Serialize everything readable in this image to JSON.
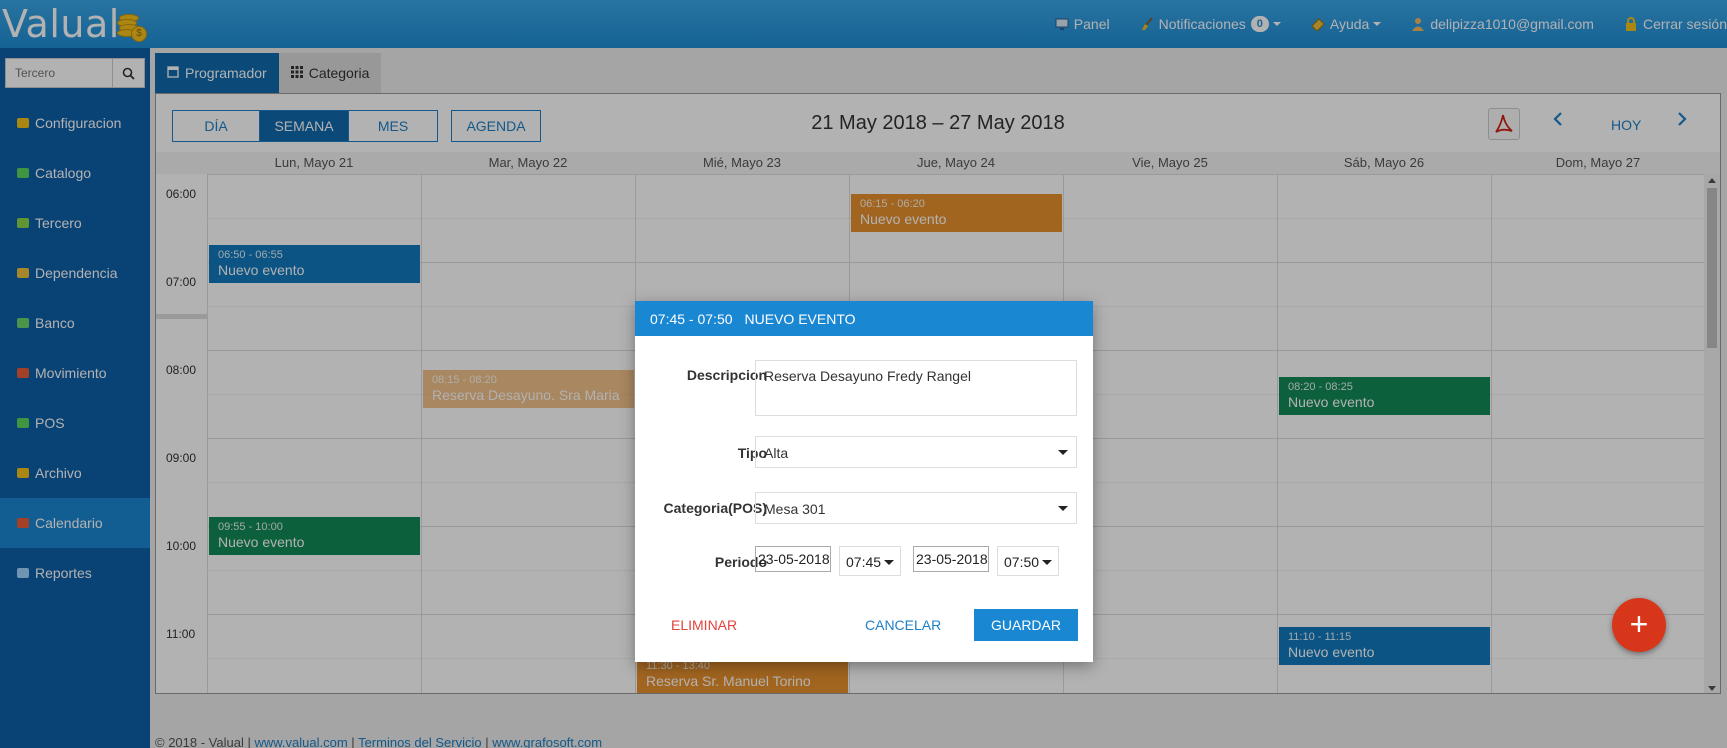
{
  "brand": {
    "logo": "Valual"
  },
  "topnav": {
    "panel": "Panel",
    "notifications": "Notificaciones",
    "notifications_count": "0",
    "help": "Ayuda",
    "user": "delipizza1010@gmail.com",
    "logout": "Cerrar sesión"
  },
  "sidebar": {
    "search_placeholder": "Tercero",
    "items": [
      {
        "label": "Configuracion",
        "icon": "gear-icon",
        "color": "#f4c21c"
      },
      {
        "label": "Catalogo",
        "icon": "share-nodes-icon",
        "color": "#5cd65c"
      },
      {
        "label": "Tercero",
        "icon": "user-icon",
        "color": "#8bd64a"
      },
      {
        "label": "Dependencia",
        "icon": "sitemap-icon",
        "color": "#f0c040"
      },
      {
        "label": "Banco",
        "icon": "money-icon",
        "color": "#6cd66c"
      },
      {
        "label": "Movimiento",
        "icon": "boxes-icon",
        "color": "#e85c3a"
      },
      {
        "label": "POS",
        "icon": "pos-icon",
        "color": "#5cd65c"
      },
      {
        "label": "Archivo",
        "icon": "archive-icon",
        "color": "#f4c21c"
      },
      {
        "label": "Calendario",
        "icon": "calendar-icon",
        "color": "#e85c3a"
      },
      {
        "label": "Reportes",
        "icon": "printer-icon",
        "color": "#9fd6ff"
      }
    ]
  },
  "tabs": {
    "programador": "Programador",
    "categoria": "Categoria"
  },
  "calendar": {
    "views": {
      "day": "DÍA",
      "week": "SEMANA",
      "month": "MES",
      "agenda": "AGENDA"
    },
    "range": "21 May 2018 – 27 May 2018",
    "today": "HOY",
    "days": [
      "Lun, Mayo 21",
      "Mar, Mayo 22",
      "Mié, Mayo 23",
      "Jue, Mayo 24",
      "Vie, Mayo 25",
      "Sáb, Mayo 26",
      "Dom, Mayo 27"
    ],
    "times": [
      "06:00",
      "07:00",
      "08:00",
      "09:00",
      "10:00",
      "11:00"
    ],
    "events": [
      {
        "day": 3,
        "time": "06:15 - 06:20",
        "name": "Nuevo evento"
      },
      {
        "day": 0,
        "time": "06:50 - 06:55",
        "name": "Nuevo evento"
      },
      {
        "day": 1,
        "time": "08:15 - 08:20",
        "name": "Reserva Desayuno. Sra Maria"
      },
      {
        "day": 5,
        "time": "08:20 - 08:25",
        "name": "Nuevo evento"
      },
      {
        "day": 0,
        "time": "09:55 - 10:00",
        "name": "Nuevo evento"
      },
      {
        "day": 5,
        "time": "11:10 - 11:15",
        "name": "Nuevo evento"
      },
      {
        "day": 2,
        "time": "11:30 - 13:40",
        "name": "Reserva Sr. Manuel Torino"
      }
    ],
    "colors": {
      "blue": "#1079bd",
      "orange": "#e8912e",
      "green": "#148a56"
    }
  },
  "modal": {
    "time": "07:45 - 07:50",
    "title": "NUEVO EVENTO",
    "desc_label": "Descripcion",
    "desc_value": "Reserva Desayuno Fredy Rangel",
    "tipo_label": "Tipo",
    "tipo_value": "Alta",
    "cat_label": "Categoria(POS)",
    "cat_value": "Mesa 301",
    "periodo_label": "Periodo",
    "start_date": "23-05-2018",
    "start_time": "07:45",
    "end_date": "23-05-2018",
    "end_time": "07:50",
    "delete": "ELIMINAR",
    "cancel": "CANCELAR",
    "save": "GUARDAR"
  },
  "footer": {
    "copyright": "© 2018 - Valual |",
    "link1": "www.valual.com",
    "sep1": "|",
    "link2": "Terminos del Servicio",
    "sep2": "|",
    "link3": "www.grafosoft.com"
  }
}
